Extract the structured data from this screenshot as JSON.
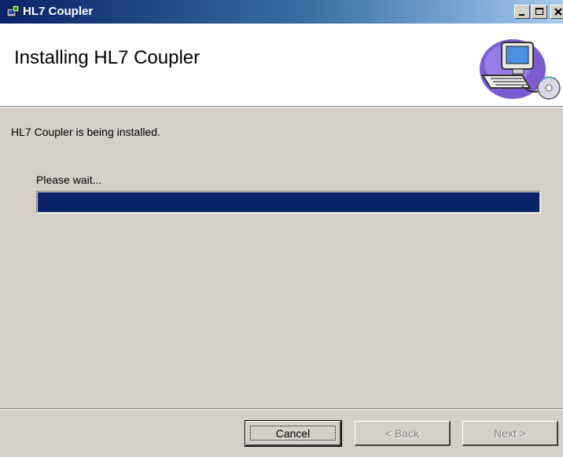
{
  "window": {
    "title": "HL7 Coupler",
    "icons": {
      "app": "installer-icon",
      "minimize": "minimize-icon",
      "maximize": "maximize-icon",
      "close": "close-icon"
    }
  },
  "banner": {
    "title": "Installing HL7 Coupler",
    "art": "computer-cd-icon"
  },
  "body": {
    "status": "HL7 Coupler is being installed.",
    "wait_label": "Please wait...",
    "progress_fraction": 1.0,
    "progress_color": "#0a246a"
  },
  "buttons": {
    "cancel": "Cancel",
    "back": "< Back",
    "next": "Next >"
  },
  "colors": {
    "titlebar_start": "#0a246a",
    "titlebar_end": "#a6caf0",
    "face": "#d4d0c8"
  }
}
